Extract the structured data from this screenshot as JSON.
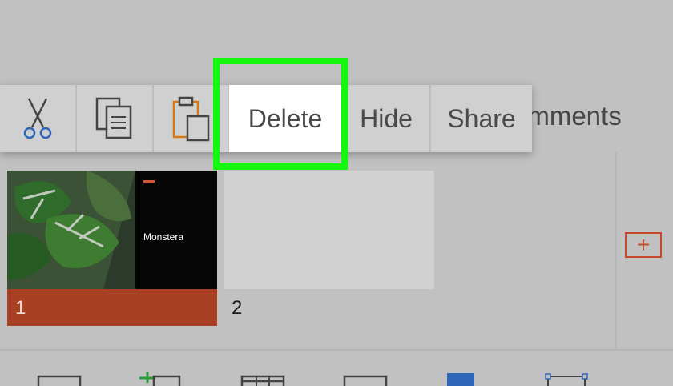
{
  "background_tab": {
    "partial_label": "omments"
  },
  "context_menu": {
    "delete_label": "Delete",
    "hide_label": "Hide",
    "share_label": "Share"
  },
  "slides": [
    {
      "number": "1",
      "title": "Monstera",
      "selected": true
    },
    {
      "number": "2",
      "title": "",
      "selected": false
    }
  ],
  "colors": {
    "highlight": "#17f60e",
    "accent": "#a84124",
    "icon_blue": "#2f66b8",
    "icon_orange": "#d07a1a"
  }
}
